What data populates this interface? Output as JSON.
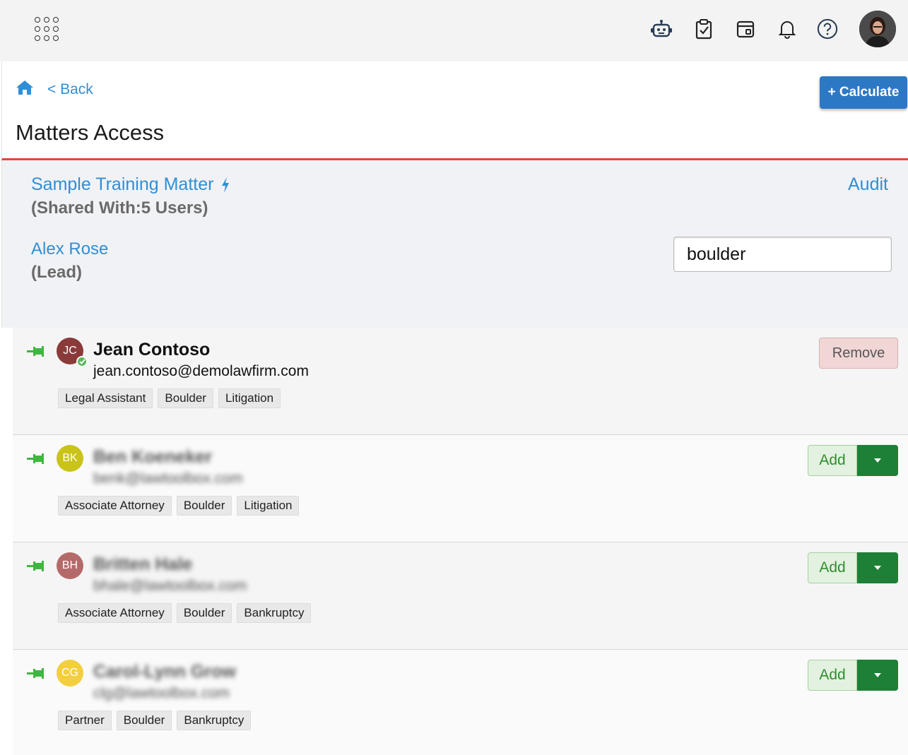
{
  "topbar": {
    "icons": [
      "app-grid-icon",
      "robot-icon",
      "clipboard-check-icon",
      "calendar-icon",
      "bell-icon",
      "help-icon"
    ]
  },
  "header": {
    "back_label": "< Back",
    "title": "Matters Access",
    "calculate_label": "+ Calculate"
  },
  "matter": {
    "name": "Sample Training Matter",
    "shared_with": "(Shared With:5 Users)",
    "lead_name": "Alex Rose",
    "lead_label": "(Lead)",
    "audit_label": "Audit",
    "search_value": "boulder"
  },
  "users": [
    {
      "initials": "JC",
      "avatar_color": "#8b3a3a",
      "name": "Jean Contoso",
      "email": "jean.contoso@demolawfirm.com",
      "tags": [
        "Legal Assistant",
        "Boulder",
        "Litigation"
      ],
      "action": "Remove",
      "verified": true
    },
    {
      "initials": "BK",
      "avatar_color": "#c9c31a",
      "name": "Ben Koeneker",
      "email": "benk@lawtoolbox.com",
      "tags": [
        "Associate Attorney",
        "Boulder",
        "Litigation"
      ],
      "action": "Add"
    },
    {
      "initials": "BH",
      "avatar_color": "#b56a6a",
      "name": "Britten Hale",
      "email": "bhale@lawtoolbox.com",
      "tags": [
        "Associate Attorney",
        "Boulder",
        "Bankruptcy"
      ],
      "action": "Add"
    },
    {
      "initials": "CG",
      "avatar_color": "#f3cf3e",
      "name": "Carol-Lynn Grow",
      "email": "clg@lawtoolbox.com",
      "tags": [
        "Partner",
        "Boulder",
        "Bankruptcy"
      ],
      "action": "Add"
    }
  ],
  "colors": {
    "accent_blue": "#2f8fd6",
    "calculate_button": "#2c78c4",
    "header_border": "#e0473c",
    "pin_green": "#3fb63f",
    "add_dropdown": "#1e7f36"
  }
}
